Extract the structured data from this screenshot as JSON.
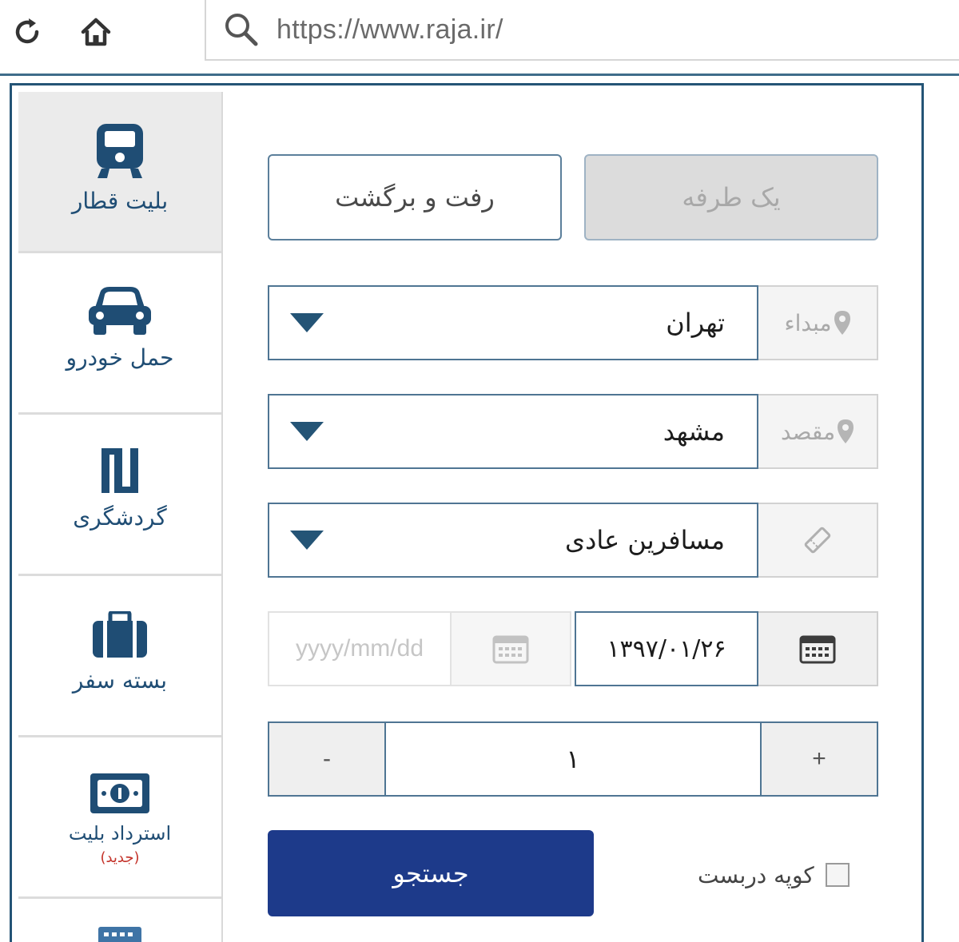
{
  "browser": {
    "url": "https://www.raja.ir/"
  },
  "sidebar": {
    "items": [
      {
        "label": "بلیت قطار",
        "icon": "train-icon",
        "active": true
      },
      {
        "label": "حمل خودرو",
        "icon": "car-icon",
        "active": false
      },
      {
        "label": "گردشگری",
        "icon": "tourism-icon",
        "active": false
      },
      {
        "label": "بسته سفر",
        "icon": "suitcase-icon",
        "active": false
      },
      {
        "label": "استرداد بلیت",
        "sub": "(جدید)",
        "icon": "refund-icon",
        "active": false
      }
    ]
  },
  "trip_type": {
    "one_way": "یک طرفه",
    "round_trip": "رفت و برگشت",
    "selected": "one_way"
  },
  "origin": {
    "label": "مبداء",
    "value": "تهران"
  },
  "destination": {
    "label": "مقصد",
    "value": "مشهد"
  },
  "passenger_type": {
    "value": "مسافرین عادی",
    "icon": "ticket-icon"
  },
  "dates": {
    "depart": "۱۳۹۷/۰۱/۲۶",
    "return_placeholder": "yyyy/mm/dd"
  },
  "passengers": {
    "count": "۱",
    "minus": "-",
    "plus": "+"
  },
  "search_label": "جستجو",
  "coupe_label": "کوپه دربست",
  "colors": {
    "primary": "#1d3a8a",
    "frame": "#245476",
    "accent_text": "#1f4d74",
    "new_badge": "#c4332a"
  }
}
